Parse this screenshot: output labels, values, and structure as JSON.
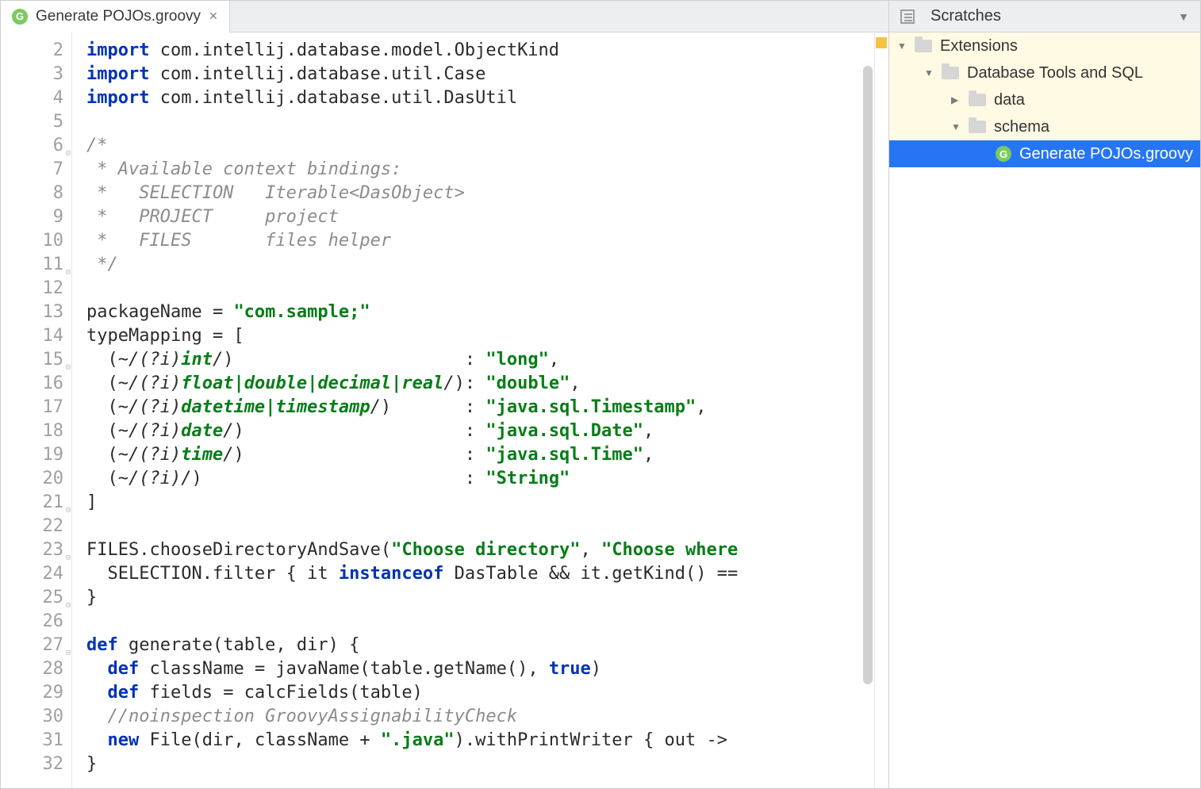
{
  "tab": {
    "label": "Generate POJOs.groovy",
    "icon_letter": "G"
  },
  "gutter": {
    "start": 2,
    "end": 32
  },
  "code_lines": [
    [
      {
        "kw": "import"
      },
      {
        "t": " com.intellij.database.model.ObjectKind"
      }
    ],
    [
      {
        "kw": "import"
      },
      {
        "t": " com.intellij.database.util.Case"
      }
    ],
    [
      {
        "kw": "import"
      },
      {
        "t": " com.intellij.database.util.DasUtil"
      }
    ],
    [
      {
        "t": ""
      }
    ],
    [
      {
        "cmt": "/*"
      }
    ],
    [
      {
        "cmt": " * Available context bindings:"
      }
    ],
    [
      {
        "cmt": " *   SELECTION   Iterable<DasObject>"
      }
    ],
    [
      {
        "cmt": " *   PROJECT     project"
      }
    ],
    [
      {
        "cmt": " *   FILES       files helper"
      }
    ],
    [
      {
        "cmt": " */"
      }
    ],
    [
      {
        "t": ""
      }
    ],
    [
      {
        "t": "packageName = "
      },
      {
        "str": "\"com.sample;\""
      }
    ],
    [
      {
        "t": "typeMapping = ["
      }
    ],
    [
      {
        "t": "  (~"
      },
      {
        "regex": "/"
      },
      {
        "regex": "(?i)"
      },
      {
        "rkw": "int"
      },
      {
        "regex": "/"
      },
      {
        "t": ")                      : "
      },
      {
        "str": "\"long\""
      },
      {
        "t": ","
      }
    ],
    [
      {
        "t": "  (~"
      },
      {
        "regex": "/"
      },
      {
        "regex": "(?i)"
      },
      {
        "rkw": "float"
      },
      {
        "rpun": "|"
      },
      {
        "rkw": "double"
      },
      {
        "rpun": "|"
      },
      {
        "rkw": "decimal"
      },
      {
        "rpun": "|"
      },
      {
        "rkw": "real"
      },
      {
        "regex": "/"
      },
      {
        "t": "): "
      },
      {
        "str": "\"double\""
      },
      {
        "t": ","
      }
    ],
    [
      {
        "t": "  (~"
      },
      {
        "regex": "/"
      },
      {
        "regex": "(?i)"
      },
      {
        "rkw": "datetime"
      },
      {
        "rpun": "|"
      },
      {
        "rkw": "timestamp"
      },
      {
        "regex": "/"
      },
      {
        "t": ")       : "
      },
      {
        "str": "\"java.sql.Timestamp\""
      },
      {
        "t": ","
      }
    ],
    [
      {
        "t": "  (~"
      },
      {
        "regex": "/"
      },
      {
        "regex": "(?i)"
      },
      {
        "rkw": "date"
      },
      {
        "regex": "/"
      },
      {
        "t": ")                     : "
      },
      {
        "str": "\"java.sql.Date\""
      },
      {
        "t": ","
      }
    ],
    [
      {
        "t": "  (~"
      },
      {
        "regex": "/"
      },
      {
        "regex": "(?i)"
      },
      {
        "rkw": "time"
      },
      {
        "regex": "/"
      },
      {
        "t": ")                     : "
      },
      {
        "str": "\"java.sql.Time\""
      },
      {
        "t": ","
      }
    ],
    [
      {
        "t": "  (~"
      },
      {
        "regex": "/"
      },
      {
        "regex": "(?i)"
      },
      {
        "regex": "/"
      },
      {
        "t": ")                         : "
      },
      {
        "str": "\"String\""
      }
    ],
    [
      {
        "t": "]"
      }
    ],
    [
      {
        "t": ""
      }
    ],
    [
      {
        "t": "FILES.chooseDirectoryAndSave("
      },
      {
        "str": "\"Choose directory\""
      },
      {
        "t": ", "
      },
      {
        "str": "\"Choose where"
      }
    ],
    [
      {
        "t": "  SELECTION.filter { it "
      },
      {
        "kw": "instanceof"
      },
      {
        "t": " DasTable && it.getKind() =="
      }
    ],
    [
      {
        "t": "}"
      }
    ],
    [
      {
        "t": ""
      }
    ],
    [
      {
        "kw": "def"
      },
      {
        "t": " generate(table, dir) {"
      }
    ],
    [
      {
        "t": "  "
      },
      {
        "kw": "def"
      },
      {
        "t": " className = javaName(table.getName(), "
      },
      {
        "kw": "true"
      },
      {
        "t": ")"
      }
    ],
    [
      {
        "t": "  "
      },
      {
        "kw": "def"
      },
      {
        "t": " fields = calcFields(table)"
      }
    ],
    [
      {
        "t": "  "
      },
      {
        "cmt": "//noinspection GroovyAssignabilityCheck"
      }
    ],
    [
      {
        "t": "  "
      },
      {
        "kw": "new"
      },
      {
        "t": " File(dir, className + "
      },
      {
        "str": "\".java\""
      },
      {
        "t": ").withPrintWriter { out ->"
      }
    ],
    [
      {
        "t": "}"
      }
    ]
  ],
  "toolwin": {
    "title": "Scratches",
    "tree": [
      {
        "level": 0,
        "label": "Extensions",
        "icon": "folder",
        "expanded": true,
        "hl": true
      },
      {
        "level": 1,
        "label": "Database Tools and SQL",
        "icon": "folder",
        "expanded": true,
        "hl": true
      },
      {
        "level": 2,
        "label": "data",
        "icon": "folder",
        "expanded": false,
        "hl": true
      },
      {
        "level": 2,
        "label": "schema",
        "icon": "folder",
        "expanded": true,
        "hl": true
      },
      {
        "level": 3,
        "label": "Generate POJOs.groovy",
        "icon": "groovy",
        "selected": true
      }
    ],
    "groovy_icon_letter": "G"
  }
}
